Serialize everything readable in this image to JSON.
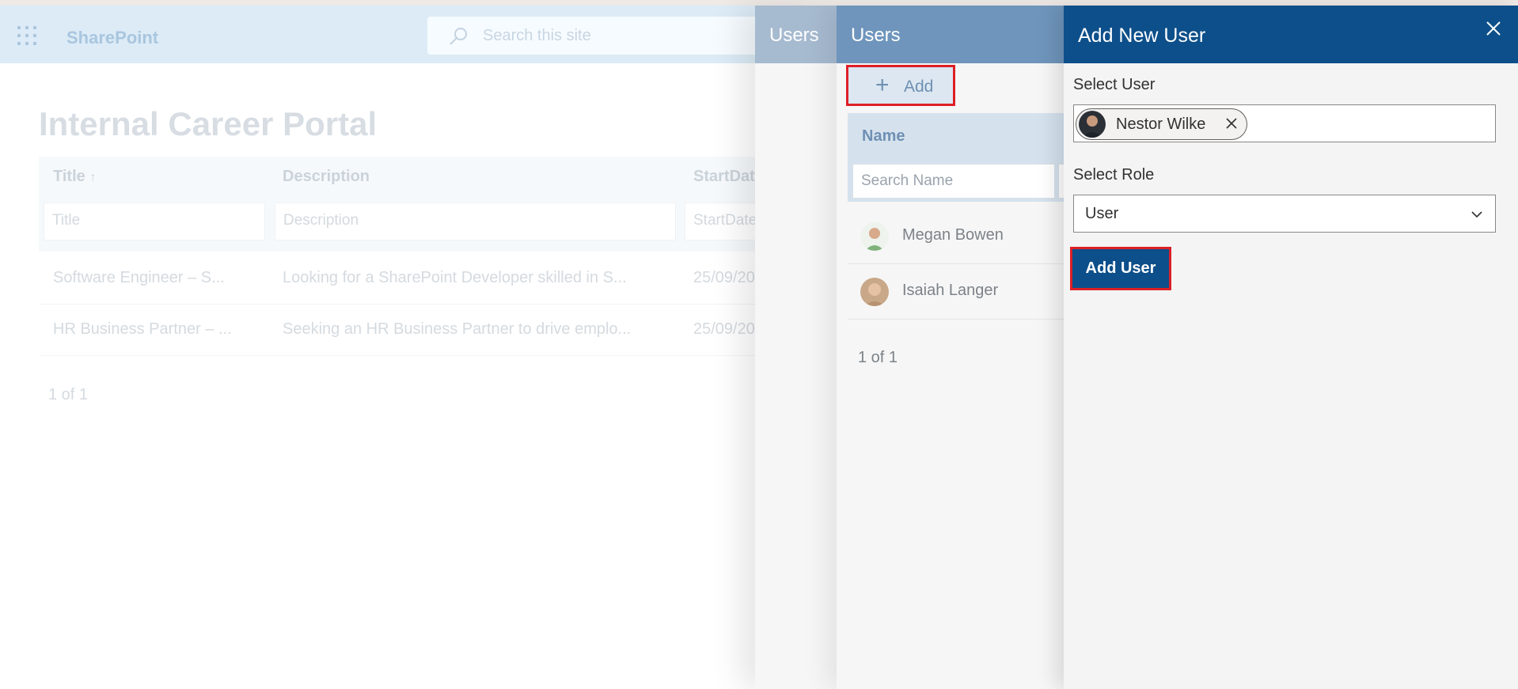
{
  "suite": {
    "brand": "SharePoint",
    "search_placeholder": "Search this site"
  },
  "portal": {
    "title": "Internal Career Portal",
    "columns": [
      "Title",
      "Description",
      "StartDat"
    ],
    "sort_indicator": "↑",
    "filter_placeholders": [
      "Title",
      "Description",
      "StartDate"
    ],
    "rows": [
      [
        "Software Engineer – S...",
        "Looking for a SharePoint Developer skilled in S...",
        "25/09/20"
      ],
      [
        "HR Business Partner – ...",
        "Seeking an HR Business Partner to drive emplo...",
        "25/09/20"
      ]
    ],
    "pagination": "1 of 1"
  },
  "panel_users_back": {
    "title": "Users"
  },
  "panel_users": {
    "title": "Users",
    "add_label": "Add",
    "column_name": "Name",
    "search_placeholder": "Search Name",
    "users": [
      {
        "name": "Megan Bowen"
      },
      {
        "name": "Isaiah Langer"
      }
    ],
    "pagination": "1 of 1"
  },
  "panel_add_user": {
    "title": "Add New User",
    "select_user_label": "Select User",
    "selected_user": "Nestor Wilke",
    "select_role_label": "Select Role",
    "role_value": "User",
    "submit_label": "Add User"
  },
  "colors": {
    "header_dark": "#0d4f8a",
    "highlight": "#dd1f26",
    "suite_bar": "#dcebf6"
  },
  "icons": [
    "waffle-icon",
    "search-icon",
    "plus-icon",
    "close-icon",
    "remove-chip-icon",
    "chevron-down-icon"
  ]
}
